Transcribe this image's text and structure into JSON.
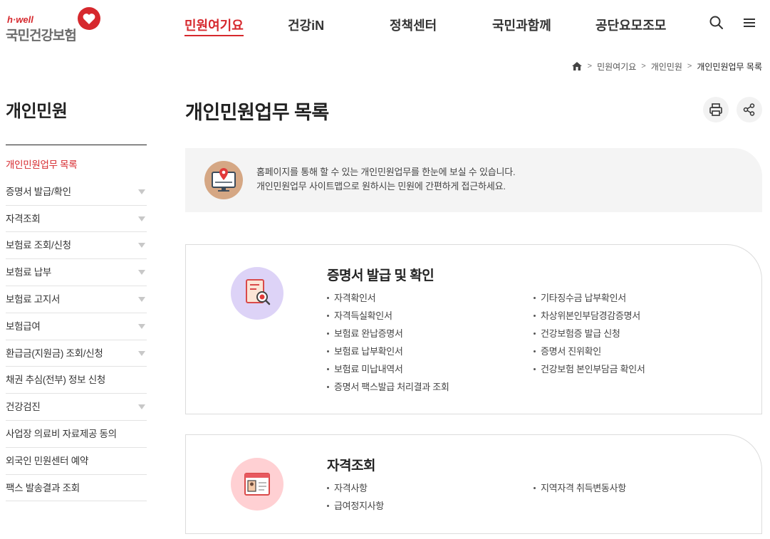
{
  "header": {
    "logo_top": "h·well",
    "logo_name": "국민건강보험",
    "nav": [
      "민원여기요",
      "건강iN",
      "정책센터",
      "국민과함께",
      "공단요모조모"
    ],
    "active_nav": 0
  },
  "breadcrumb": [
    "민원여기요",
    "개인민원",
    "개인민원업무 목록"
  ],
  "sidebar": {
    "title": "개인민원",
    "items": [
      {
        "label": "개인민원업무 목록",
        "active": true,
        "arrow": false
      },
      {
        "label": "증명서 발급/확인",
        "arrow": true
      },
      {
        "label": "자격조회",
        "arrow": true
      },
      {
        "label": "보험료 조회/신청",
        "arrow": true
      },
      {
        "label": "보험료 납부",
        "arrow": true
      },
      {
        "label": "보험료 고지서",
        "arrow": true
      },
      {
        "label": "보험급여",
        "arrow": true
      },
      {
        "label": "환급금(지원금) 조회/신청",
        "arrow": true
      },
      {
        "label": "채권 추심(전부) 정보 신청",
        "arrow": false
      },
      {
        "label": "건강검진",
        "arrow": true
      },
      {
        "label": "사업장 의료비 자료제공 동의",
        "arrow": false
      },
      {
        "label": "외국인 민원센터 예약",
        "arrow": false
      },
      {
        "label": "팩스 발송결과 조회",
        "arrow": false
      }
    ]
  },
  "main": {
    "title": "개인민원업무 목록",
    "intro_line1": "홈페이지를 통해 할 수 있는 개인민원업무를 한눈에 보실 수 있습니다.",
    "intro_line2": "개인민원업무 사이트맵으로 원하시는 민원에 간편하게 접근하세요.",
    "cards": [
      {
        "title": "증명서 발급 및 확인",
        "icon": "certificate-search-icon",
        "icon_bg": "#ddd3f7",
        "items": [
          "자격확인서",
          "기타징수금 납부확인서",
          "자격득실확인서",
          "차상위본인부담경감증명서",
          "보험료 완납증명서",
          "건강보험증 발급 신청",
          "보험료 납부확인서",
          "증명서 진위확인",
          "보험료 미납내역서",
          "건강보험 본인부담금 확인서",
          "증명서 팩스발급 처리결과 조회"
        ]
      },
      {
        "title": "자격조회",
        "icon": "id-card-icon",
        "icon_bg": "#ffd0d3",
        "items": [
          "자격사항",
          "지역자격 취득변동사항",
          "급여정지사항"
        ]
      }
    ]
  },
  "colors": {
    "accent": "#d6282d"
  }
}
